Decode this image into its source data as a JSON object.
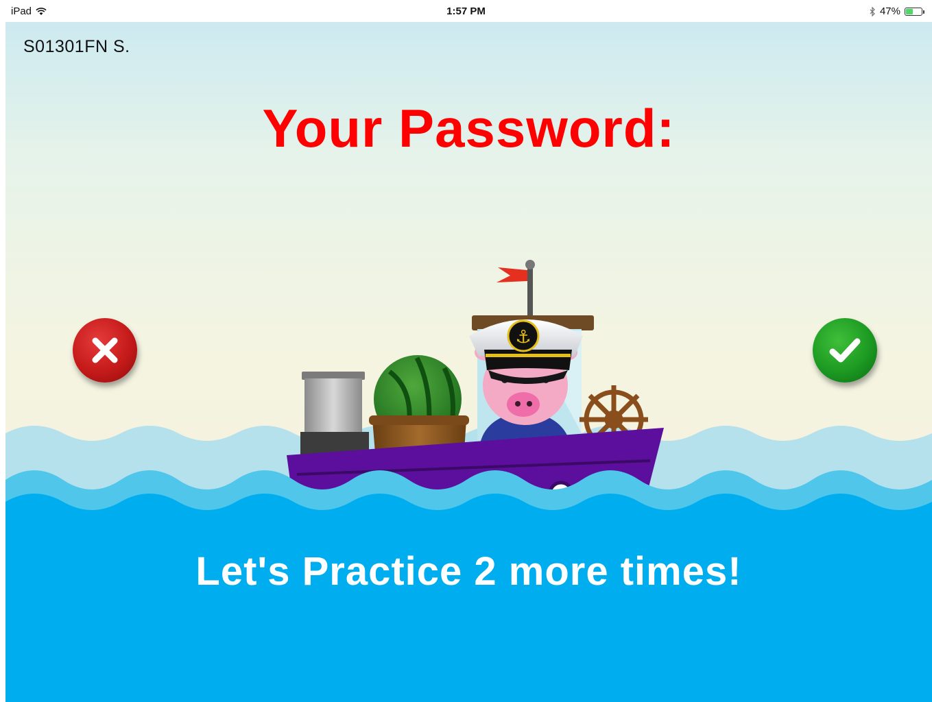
{
  "status_bar": {
    "device": "iPad",
    "time": "1:57 PM",
    "battery_text": "47%",
    "battery_level": 0.47,
    "icons": [
      "wifi-icon",
      "bluetooth-icon",
      "battery-icon"
    ]
  },
  "user": {
    "id": "S01301FN S."
  },
  "heading": "Your Password:",
  "buttons": {
    "reject_icon": "close-icon",
    "accept_icon": "checkmark-icon"
  },
  "message": "Let's Practice 2 more times!",
  "colors": {
    "title": "#ff0000",
    "water": "#00adee",
    "reject": "#c51a1a",
    "accept": "#1c9a22",
    "boat_hull": "#5c0f9c"
  },
  "illustration": [
    "flag-icon",
    "captain-pig-icon",
    "watermelon-icon",
    "ship-wheel-icon",
    "boat-icon",
    "waves-icon"
  ]
}
